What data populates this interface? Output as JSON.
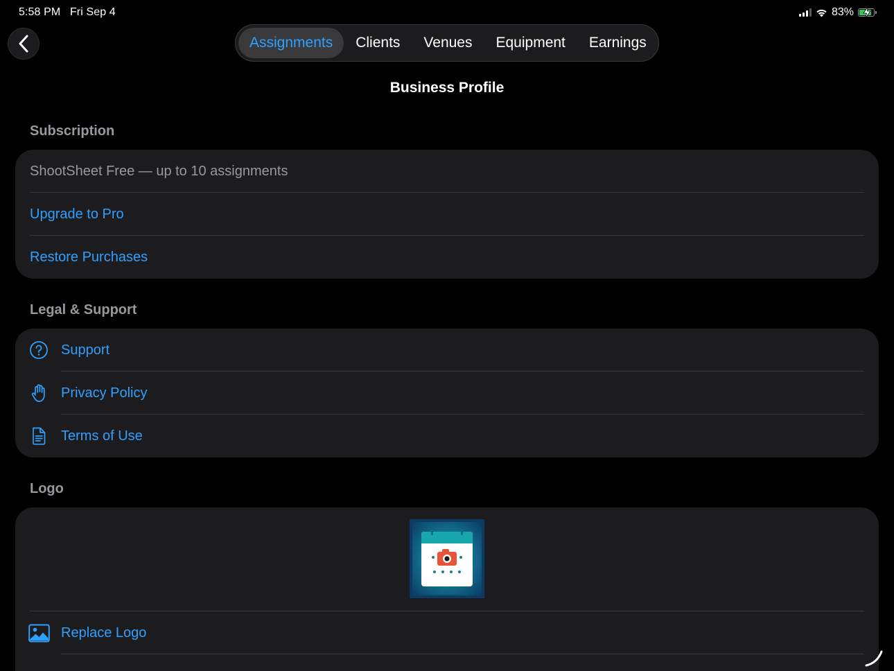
{
  "status_bar": {
    "time": "5:58 PM",
    "date": "Fri Sep 4",
    "battery_percent": "83%",
    "battery_level": 0.83,
    "battery_color": "#34c759"
  },
  "nav": {
    "back_icon": "chevron-left-icon",
    "tabs": [
      {
        "label": "Assignments",
        "active": true
      },
      {
        "label": "Clients",
        "active": false
      },
      {
        "label": "Venues",
        "active": false
      },
      {
        "label": "Equipment",
        "active": false
      },
      {
        "label": "Earnings",
        "active": false
      }
    ],
    "accent_color": "#2fa0ff"
  },
  "page_title": "Business Profile",
  "subscription": {
    "header": "Subscription",
    "plan": "ShootSheet Free — up to 10 assignments",
    "upgrade_label": "Upgrade to Pro",
    "restore_label": "Restore Purchases"
  },
  "legal": {
    "header": "Legal & Support",
    "items": [
      {
        "label": "Support",
        "icon": "question-circle-icon"
      },
      {
        "label": "Privacy Policy",
        "icon": "hand-raised-icon"
      },
      {
        "label": "Terms of Use",
        "icon": "document-icon"
      }
    ]
  },
  "logo": {
    "header": "Logo",
    "image_icon": "calendar-camera-logo",
    "replace_label": "Replace Logo",
    "replace_icon": "photo-icon"
  }
}
